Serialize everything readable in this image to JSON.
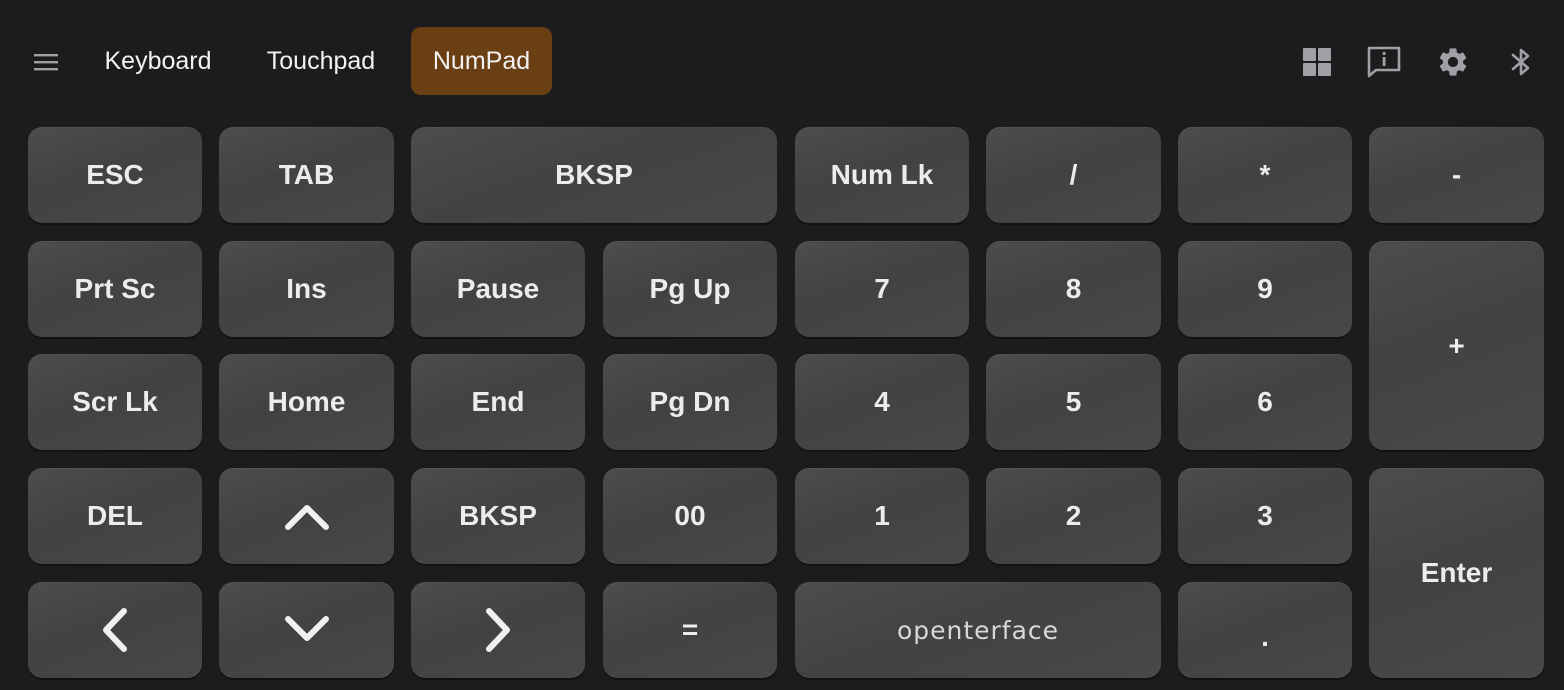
{
  "topbar": {
    "tabs": [
      {
        "label": "Keyboard",
        "active": false
      },
      {
        "label": "Touchpad",
        "active": false
      },
      {
        "label": "NumPad",
        "active": true
      }
    ],
    "icons": [
      "menu-icon",
      "grid-layout-icon",
      "feedback-icon",
      "gear-icon",
      "bluetooth-icon"
    ]
  },
  "keys": {
    "esc": "ESC",
    "tab": "TAB",
    "bksp_top": "BKSP",
    "numlk": "Num Lk",
    "divide": "/",
    "multiply": "*",
    "minus": "-",
    "prtsc": "Prt Sc",
    "ins": "Ins",
    "pause": "Pause",
    "pgup": "Pg Up",
    "n7": "7",
    "n8": "8",
    "n9": "9",
    "plus": "+",
    "scrlk": "Scr Lk",
    "home": "Home",
    "end": "End",
    "pgdn": "Pg Dn",
    "n4": "4",
    "n5": "5",
    "n6": "6",
    "del": "DEL",
    "bksp_mid": "BKSP",
    "n00": "00",
    "n1": "1",
    "n2": "2",
    "n3": "3",
    "enter": "Enter",
    "equals": "=",
    "brand": "openterface",
    "dot": "."
  },
  "arrows": {
    "up": "arrow-up-icon",
    "down": "arrow-down-icon",
    "left": "arrow-left-icon",
    "right": "arrow-right-icon"
  },
  "colors": {
    "background": "#1c1c1e",
    "key": "#454547",
    "active_tab": "#6a3f13",
    "text": "#ececec"
  }
}
